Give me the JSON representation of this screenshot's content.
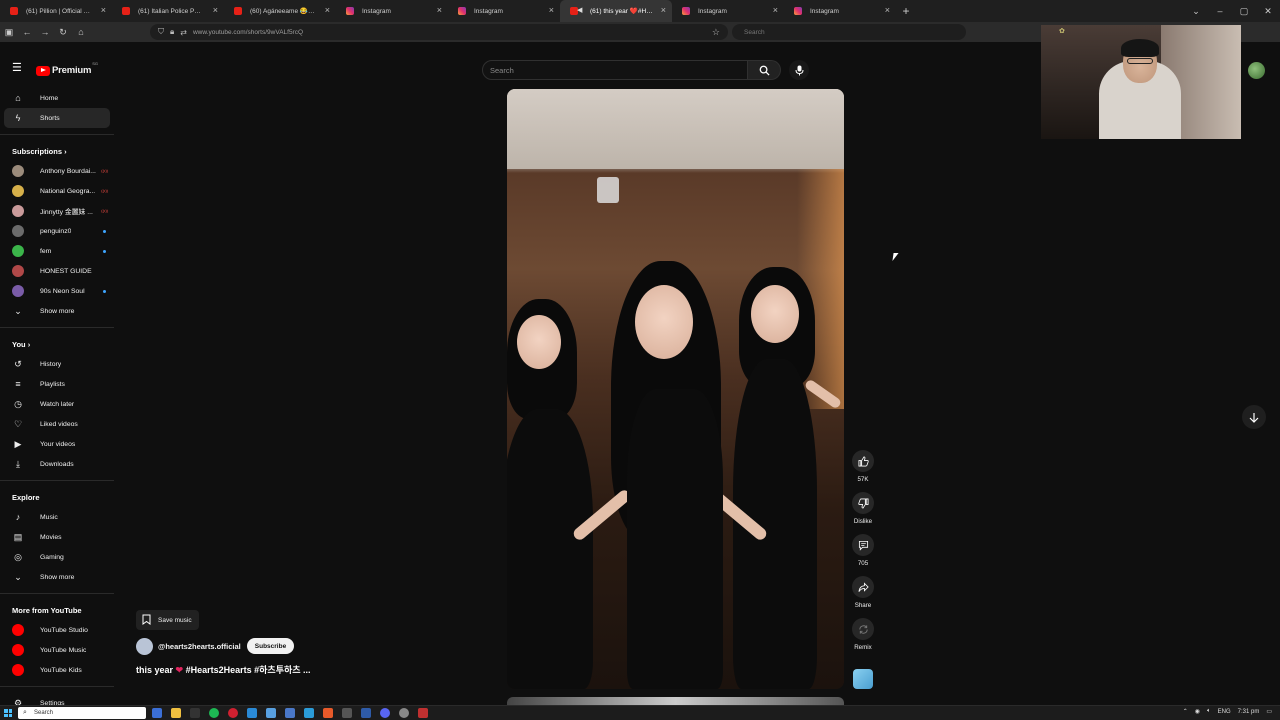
{
  "browser": {
    "tabs": [
      {
        "title": "(61) Pillion | Official Trailer HD |",
        "favicon": "youtube",
        "active": false
      },
      {
        "title": "(61) Italian Police Pulls Over Fe",
        "favicon": "youtube",
        "active": false
      },
      {
        "title": "(60) Agáneeame 😂#shorts - You",
        "favicon": "youtube",
        "active": false
      },
      {
        "title": "Instagram",
        "favicon": "instagram",
        "active": false
      },
      {
        "title": "Instagram",
        "favicon": "instagram",
        "active": false
      },
      {
        "title": "(61) this year ❤️#Hearts2H",
        "favicon": "youtube",
        "active": true
      },
      {
        "title": "Instagram",
        "favicon": "instagram",
        "active": false
      },
      {
        "title": "Instagram",
        "favicon": "instagram",
        "active": false
      }
    ],
    "url": "www.youtube.com/shorts/9wVALf5rcQ",
    "search_placeholder": "Search"
  },
  "youtube": {
    "logo_text": "Premium",
    "logo_sup": "SG",
    "search_placeholder": "Search"
  },
  "sidebar": {
    "main": [
      {
        "label": "Home",
        "icon": "home-icon"
      },
      {
        "label": "Shorts",
        "icon": "shorts-icon",
        "active": true
      }
    ],
    "subscriptions_heading": "Subscriptions",
    "subscriptions": [
      {
        "label": "Anthony Bourdai...",
        "color": "#9b8b7b",
        "indicator": "live"
      },
      {
        "label": "National Geogra...",
        "color": "#d6b04a",
        "indicator": "live"
      },
      {
        "label": "Jinnytty 金麗妹 ...",
        "color": "#c99a9a",
        "indicator": "live"
      },
      {
        "label": "penguinz0",
        "color": "#6b6b6b",
        "indicator": "dot"
      },
      {
        "label": "fem",
        "color": "#3bb54a",
        "indicator": "dot"
      },
      {
        "label": "HONEST GUIDE",
        "color": "#b04848",
        "indicator": "none"
      },
      {
        "label": "90s Neon Soul",
        "color": "#7a5ca8",
        "indicator": "dot"
      }
    ],
    "show_more_1": "Show more",
    "you_heading": "You",
    "you_items": [
      {
        "label": "History",
        "icon": "history-icon"
      },
      {
        "label": "Playlists",
        "icon": "playlists-icon"
      },
      {
        "label": "Watch later",
        "icon": "watch-later-icon"
      },
      {
        "label": "Liked videos",
        "icon": "liked-videos-icon"
      },
      {
        "label": "Your videos",
        "icon": "your-videos-icon"
      },
      {
        "label": "Downloads",
        "icon": "downloads-icon"
      }
    ],
    "explore_heading": "Explore",
    "explore_items": [
      {
        "label": "Music",
        "icon": "music-icon"
      },
      {
        "label": "Movies",
        "icon": "movies-icon"
      },
      {
        "label": "Gaming",
        "icon": "gaming-icon"
      }
    ],
    "show_more_2": "Show more",
    "more_heading": "More from YouTube",
    "more_items": [
      {
        "label": "YouTube Studio"
      },
      {
        "label": "YouTube Music"
      },
      {
        "label": "YouTube Kids"
      }
    ],
    "settings": "Settings"
  },
  "short": {
    "save_music": "Save music",
    "channel": "@hearts2hearts.official",
    "subscribe": "Subscribe",
    "title_prefix": "this year",
    "title_suffix": "#Hearts2Hearts #하츠투하츠 ...",
    "likes": "57K",
    "dislike": "Dislike",
    "comments": "705",
    "share": "Share",
    "remix": "Remix"
  },
  "taskbar": {
    "search_placeholder": "Search",
    "lang": "ENG",
    "time": "7:31 pm"
  },
  "colors": {
    "brand_red": "#ff0000",
    "background": "#0f0f0f",
    "accent_blue": "#3ea6ff"
  }
}
